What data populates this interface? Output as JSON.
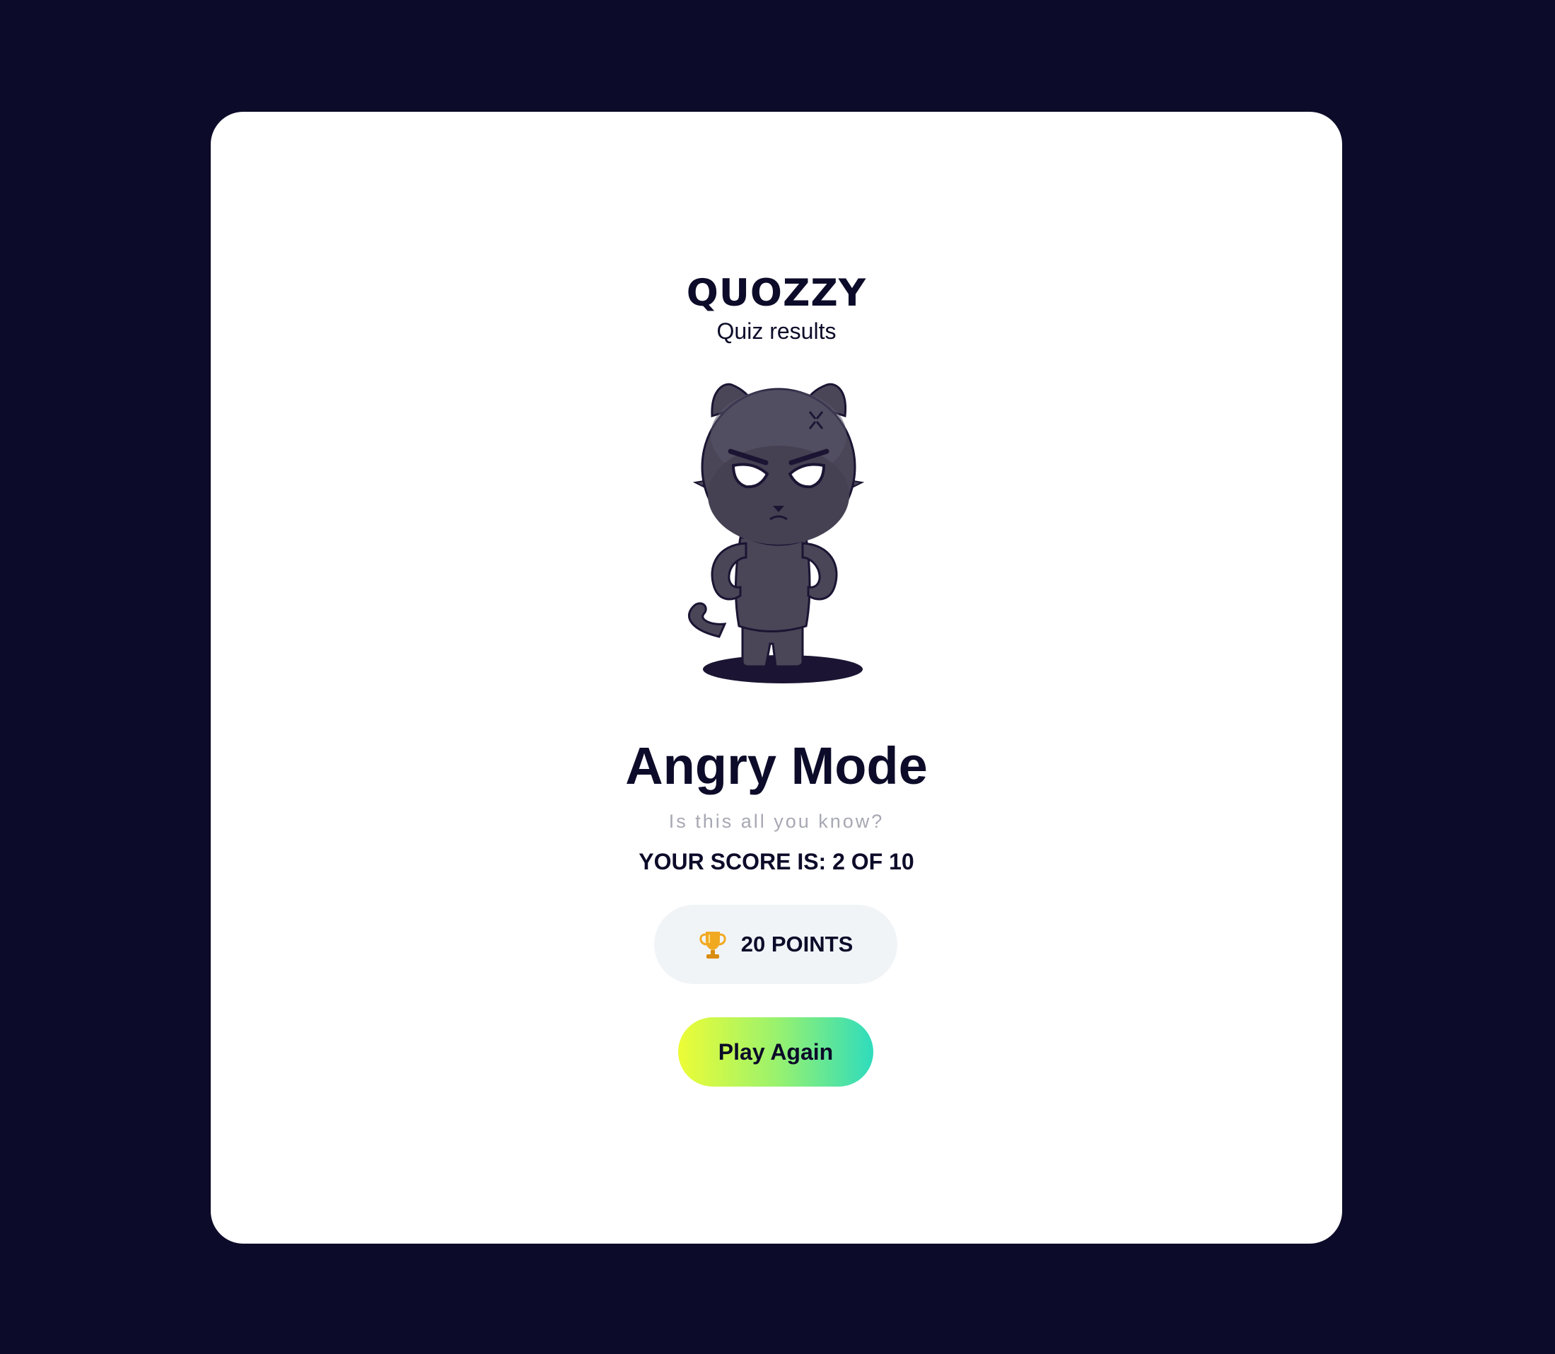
{
  "app": {
    "brand": "QUOZZY",
    "subtitle": "Quiz results"
  },
  "result": {
    "title": "Angry Mode",
    "tagline": "Is this all you know?",
    "score_text": "YOUR SCORE IS: 2 OF 10",
    "score": 2,
    "total": 10,
    "points_label": "20 POINTS",
    "mascot": "angry-cat-mascot"
  },
  "actions": {
    "play_again_label": "Play Again"
  },
  "icons": {
    "points": "trophy-icon"
  },
  "colors": {
    "background": "#0c0b29",
    "card": "#ffffff",
    "text_primary": "#0c0b29",
    "text_muted": "#a7a8b3",
    "pill_bg": "#f1f4f7",
    "button_gradient_start": "#edfc36",
    "button_gradient_end": "#2fdcbd"
  }
}
